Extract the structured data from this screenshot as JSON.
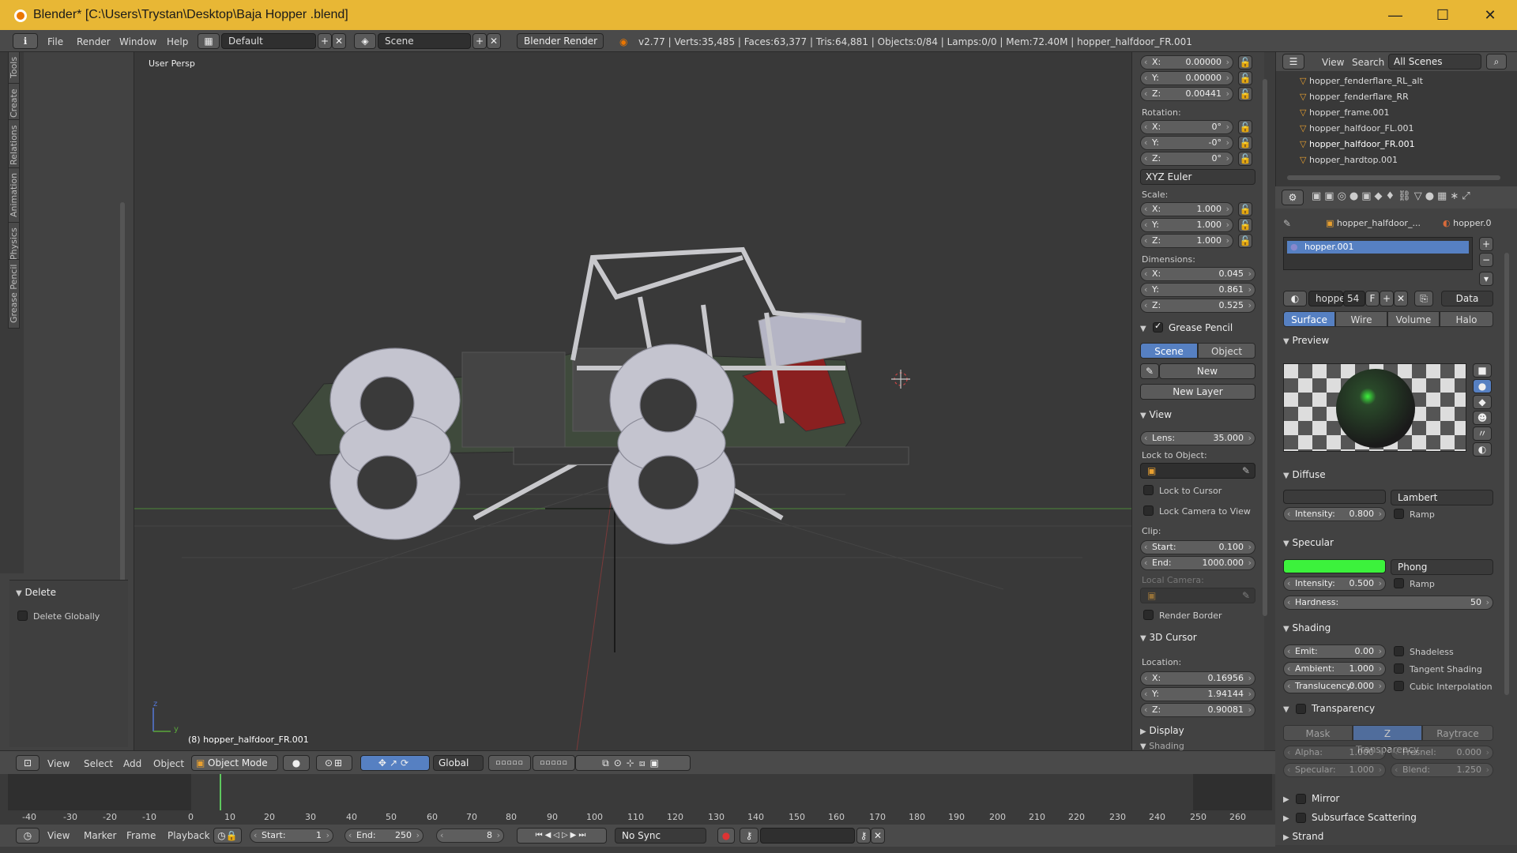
{
  "window": {
    "title": "Blender* [C:\\Users\\Trystan\\Desktop\\Baja Hopper .blend]"
  },
  "infobar": {
    "menus": [
      "File",
      "Render",
      "Window",
      "Help"
    ],
    "layout": "Default",
    "scene": "Scene",
    "engine": "Blender Render",
    "stats": "v2.77 | Verts:35,485 | Faces:63,377 | Tris:64,881 | Objects:0/84 | Lamps:0/0 | Mem:72.40M | hopper_halfdoor_FR.001"
  },
  "toolshelf": {
    "tabs": [
      "Tools",
      "Create",
      "Relations",
      "Animation",
      "Physics",
      "Grease Pencil"
    ],
    "operator_title": "Delete",
    "delete_globally": "Delete Globally"
  },
  "viewport": {
    "label": "User Persp",
    "object_label": "(8) hopper_halfdoor_FR.001",
    "axis_z": "z",
    "axis_y": "y"
  },
  "transform": {
    "location": [
      {
        "axis": "X:",
        "value": "0.00000"
      },
      {
        "axis": "Y:",
        "value": "0.00000"
      },
      {
        "axis": "Z:",
        "value": "0.00441"
      }
    ],
    "rotation_label": "Rotation:",
    "rotation": [
      {
        "axis": "X:",
        "value": "0°"
      },
      {
        "axis": "Y:",
        "value": "-0°"
      },
      {
        "axis": "Z:",
        "value": "0°"
      }
    ],
    "rotation_mode": "XYZ Euler",
    "scale_label": "Scale:",
    "scale": [
      {
        "axis": "X:",
        "value": "1.000"
      },
      {
        "axis": "Y:",
        "value": "1.000"
      },
      {
        "axis": "Z:",
        "value": "1.000"
      }
    ],
    "dimensions_label": "Dimensions:",
    "dimensions": [
      {
        "axis": "X:",
        "value": "0.045"
      },
      {
        "axis": "Y:",
        "value": "0.861"
      },
      {
        "axis": "Z:",
        "value": "0.525"
      }
    ]
  },
  "grease_pencil": {
    "title": "Grease Pencil",
    "scene_tab": "Scene",
    "object_tab": "Object",
    "new": "New",
    "new_layer": "New Layer"
  },
  "view_panel": {
    "title": "View",
    "lens_label": "Lens:",
    "lens": "35.000",
    "lock_to_object": "Lock to Object:",
    "lock_to_cursor": "Lock to Cursor",
    "lock_camera": "Lock Camera to View",
    "clip_label": "Clip:",
    "clip_start_label": "Start:",
    "clip_start": "0.100",
    "clip_end_label": "End:",
    "clip_end": "1000.000",
    "local_camera": "Local Camera:",
    "render_border": "Render Border"
  },
  "cursor_panel": {
    "title": "3D Cursor",
    "location_label": "Location:",
    "location": [
      {
        "axis": "X:",
        "value": "0.16956"
      },
      {
        "axis": "Y:",
        "value": "1.94144"
      },
      {
        "axis": "Z:",
        "value": "0.90081"
      }
    ],
    "display": "Display",
    "shading": "Shading"
  },
  "outliner": {
    "view": "View",
    "search": "Search",
    "scenes": "All Scenes",
    "rows": [
      "hopper_fenderflare_RL_alt",
      "hopper_fenderflare_RR",
      "hopper_frame.001",
      "hopper_halfdoor_FL.001",
      "hopper_halfdoor_FR.001",
      "hopper_hardtop.001"
    ]
  },
  "material": {
    "breadcrumb_obj": "hopper_halfdoor_...",
    "breadcrumb_mat": "hopper.0",
    "slot": "hopper.001",
    "mat_name": "hopper.",
    "users": "54",
    "fake": "F",
    "link": "Data",
    "tabs": [
      "Surface",
      "Wire",
      "Volume",
      "Halo"
    ],
    "preview": "Preview",
    "diffuse": "Diffuse",
    "diffuse_shader": "Lambert",
    "intensity_label": "Intensity:",
    "diffuse_intensity": "0.800",
    "ramp": "Ramp",
    "specular": "Specular",
    "spec_shader": "Phong",
    "spec_intensity": "0.500",
    "hardness_label": "Hardness:",
    "hardness": "50",
    "shading": "Shading",
    "emit_label": "Emit:",
    "emit": "0.00",
    "ambient_label": "Ambient:",
    "ambient": "1.000",
    "translucency_label": "Translucency:",
    "translucency": "0.000",
    "shadeless": "Shadeless",
    "tangent": "Tangent Shading",
    "cubic": "Cubic Interpolation",
    "transparency": "Transparency",
    "trans_tabs": [
      "Mask",
      "Z Transparency",
      "Raytrace"
    ],
    "alpha_label": "Alpha:",
    "alpha": "1.000",
    "fresnel_label": "Fresnel:",
    "fresnel": "0.000",
    "spec_label": "Specular:",
    "spec_val": "1.000",
    "blend_label": "Blend:",
    "blend": "1.250",
    "mirror": "Mirror",
    "sss": "Subsurface Scattering",
    "strand": "Strand",
    "colors": {
      "diffuse": "#3b3b3b",
      "specular": "#3cf23c"
    }
  },
  "vp_header": {
    "menus": [
      "View",
      "Select",
      "Add",
      "Object"
    ],
    "mode": "Object Mode",
    "orientation": "Global"
  },
  "timeline": {
    "ticks": [
      "-40",
      "-30",
      "-20",
      "-10",
      "0",
      "10",
      "20",
      "30",
      "40",
      "50",
      "60",
      "70",
      "80",
      "90",
      "100",
      "110",
      "120",
      "130",
      "140",
      "150",
      "160",
      "170",
      "180",
      "190",
      "200",
      "210",
      "220",
      "230",
      "240",
      "250",
      "260"
    ],
    "menus": [
      "View",
      "Marker",
      "Frame",
      "Playback"
    ],
    "start_label": "Start:",
    "start": "1",
    "end_label": "End:",
    "end": "250",
    "current": "8",
    "sync": "No Sync"
  }
}
